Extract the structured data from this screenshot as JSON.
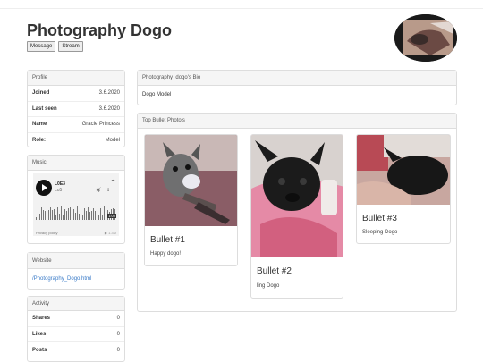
{
  "header": {
    "title": "Photography Dogo",
    "buttons": [
      "Message",
      "Stream"
    ]
  },
  "profile": {
    "heading": "Profile",
    "rows": [
      {
        "key": "Joined",
        "value": "3.6.2020"
      },
      {
        "key": "Last seen",
        "value": "3.6.2020"
      },
      {
        "key": "Name",
        "value": "Gracie Princess"
      },
      {
        "key": "Role:",
        "value": "Model"
      }
    ]
  },
  "music": {
    "heading": "Music",
    "track_title": "L0E3",
    "track_artist": "Lo5",
    "duration": "1:00",
    "privacy": "Privacy policy",
    "plays": "▶ 1.3M"
  },
  "website": {
    "heading": "Website",
    "link": "/Photography_Dogo.html"
  },
  "activity": {
    "heading": "Activity",
    "rows": [
      {
        "key": "Shares",
        "value": "0"
      },
      {
        "key": "Likes",
        "value": "0"
      },
      {
        "key": "Posts",
        "value": "0"
      }
    ]
  },
  "bio": {
    "heading": "Photography_dogo's Bio",
    "text": "Dogo Model"
  },
  "photos": {
    "heading": "Top Bullet Photo's",
    "items": [
      {
        "title": "Bullet #1",
        "caption": "Happy dogo!"
      },
      {
        "title": "Bullet #2",
        "caption": "ling Dogo"
      },
      {
        "title": "Bullet #3",
        "caption": "Sleeping Dogo"
      }
    ]
  }
}
